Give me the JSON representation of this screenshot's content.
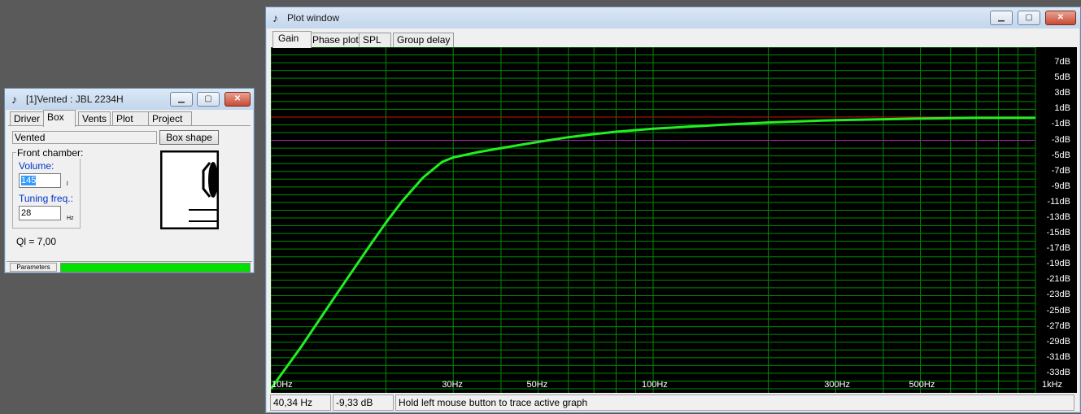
{
  "box_window": {
    "title": "[1]Vented : JBL 2234H",
    "tabs": [
      "Driver",
      "Box",
      "Vents",
      "Plot",
      "Project"
    ],
    "active_tab": "Box",
    "box_type": "Vented",
    "box_shape_button": "Box shape",
    "front_chamber_label": "Front chamber:",
    "volume_label": "Volume:",
    "volume_value": "145",
    "volume_unit": "l",
    "tuning_label": "Tuning freq.:",
    "tuning_value": "28",
    "tuning_unit": "Hz",
    "ql_text": "Ql = 7,00",
    "status_label": "Parameters",
    "status_color": "#00e000"
  },
  "plot_window": {
    "title": "Plot window",
    "tabs": [
      "Gain",
      "Phase plot",
      "SPL",
      "Group delay"
    ],
    "active_tab": "Gain",
    "status": {
      "frequency": "40,34 Hz",
      "level": "-9,33 dB",
      "hint": "Hold left mouse button to trace active graph"
    },
    "colors": {
      "background": "#000000",
      "grid": "#008a00",
      "curve": "#22ee22",
      "ref_line_red": "#cc0000",
      "ref_line_magenta": "#aa22aa"
    }
  },
  "chart_data": {
    "type": "line",
    "x_scale": "log",
    "xlim": [
      10,
      1000
    ],
    "ylim": [
      -35,
      9
    ],
    "x_tick_labels": [
      "10Hz",
      "30Hz",
      "50Hz",
      "100Hz",
      "300Hz",
      "500Hz",
      "1kHz"
    ],
    "x_ticks": [
      10,
      30,
      50,
      100,
      300,
      500,
      1000
    ],
    "y_tick_labels": [
      "7dB",
      "5dB",
      "3dB",
      "1dB",
      "-1dB",
      "-3dB",
      "-5dB",
      "-7dB",
      "-9dB",
      "-11dB",
      "-13dB",
      "-15dB",
      "-17dB",
      "-19dB",
      "-21dB",
      "-23dB",
      "-25dB",
      "-27dB",
      "-29dB",
      "-31dB",
      "-33dB"
    ],
    "y_ticks": [
      7,
      5,
      3,
      1,
      -1,
      -3,
      -5,
      -7,
      -9,
      -11,
      -13,
      -15,
      -17,
      -19,
      -21,
      -23,
      -25,
      -27,
      -29,
      -31,
      -33
    ],
    "reference_lines": [
      0,
      -3
    ],
    "series": [
      {
        "x": [
          10,
          12,
          15,
          18,
          20,
          22,
          25,
          28,
          30,
          35,
          40,
          50,
          60,
          70,
          80,
          100,
          150,
          200,
          300,
          500,
          700,
          1000
        ],
        "y": [
          -35,
          -29.6,
          -22.5,
          -16.8,
          -13.6,
          -10.9,
          -7.8,
          -5.8,
          -5.2,
          -4.5,
          -4.0,
          -3.2,
          -2.6,
          -2.2,
          -1.9,
          -1.5,
          -1.0,
          -0.7,
          -0.4,
          -0.2,
          -0.1,
          -0.1
        ]
      }
    ],
    "grid": true
  }
}
